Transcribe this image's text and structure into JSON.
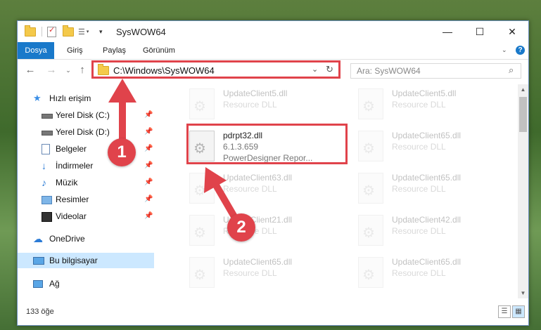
{
  "window": {
    "title": "SysWOW64"
  },
  "ribbon": {
    "tabs": [
      "Dosya",
      "Giriş",
      "Paylaş",
      "Görünüm"
    ]
  },
  "address": {
    "path": "C:\\Windows\\SysWOW64"
  },
  "search": {
    "placeholder": "Ara: SysWOW64"
  },
  "sidebar": {
    "items": [
      {
        "label": "Hızlı erişim",
        "pinned": false
      },
      {
        "label": "Yerel Disk (C:)",
        "pinned": true
      },
      {
        "label": "Yerel Disk (D:)",
        "pinned": true
      },
      {
        "label": "Belgeler",
        "pinned": true
      },
      {
        "label": "İndirmeler",
        "pinned": true
      },
      {
        "label": "Müzik",
        "pinned": true
      },
      {
        "label": "Resimler",
        "pinned": true
      },
      {
        "label": "Videolar",
        "pinned": true
      },
      {
        "label": "OneDrive",
        "pinned": false
      },
      {
        "label": "Bu bilgisayar",
        "pinned": false
      },
      {
        "label": "Ağ",
        "pinned": false
      }
    ]
  },
  "files": [
    {
      "name": "UpdateClient5.dll",
      "desc": "Resource DLL"
    },
    {
      "name": "UpdateClient5.dll",
      "desc": "Resource DLL"
    },
    {
      "name": "UpdateClient65.dll",
      "desc": "Resource DLL"
    },
    {
      "name": "UpdateClient63.dll",
      "desc": "Resource DLL"
    },
    {
      "name": "UpdateClient65.dll",
      "desc": "Resource DLL"
    },
    {
      "name": "UpdateClient21.dll",
      "desc": "Resource DLL"
    },
    {
      "name": "UpdateClient42.dll",
      "desc": "Resource DLL"
    },
    {
      "name": "UpdateClient65.dll",
      "desc": "Resource DLL"
    },
    {
      "name": "UpdateClient65.dll",
      "desc": "Resource DLL"
    }
  ],
  "highlighted_file": {
    "name": "pdrpt32.dll",
    "version": "6.1.3.659",
    "desc": "PowerDesigner Repor..."
  },
  "status": {
    "count": "133 öğe"
  },
  "callouts": {
    "one": "1",
    "two": "2"
  },
  "colors": {
    "accent": "#1979ca",
    "highlight": "#e0434b"
  }
}
